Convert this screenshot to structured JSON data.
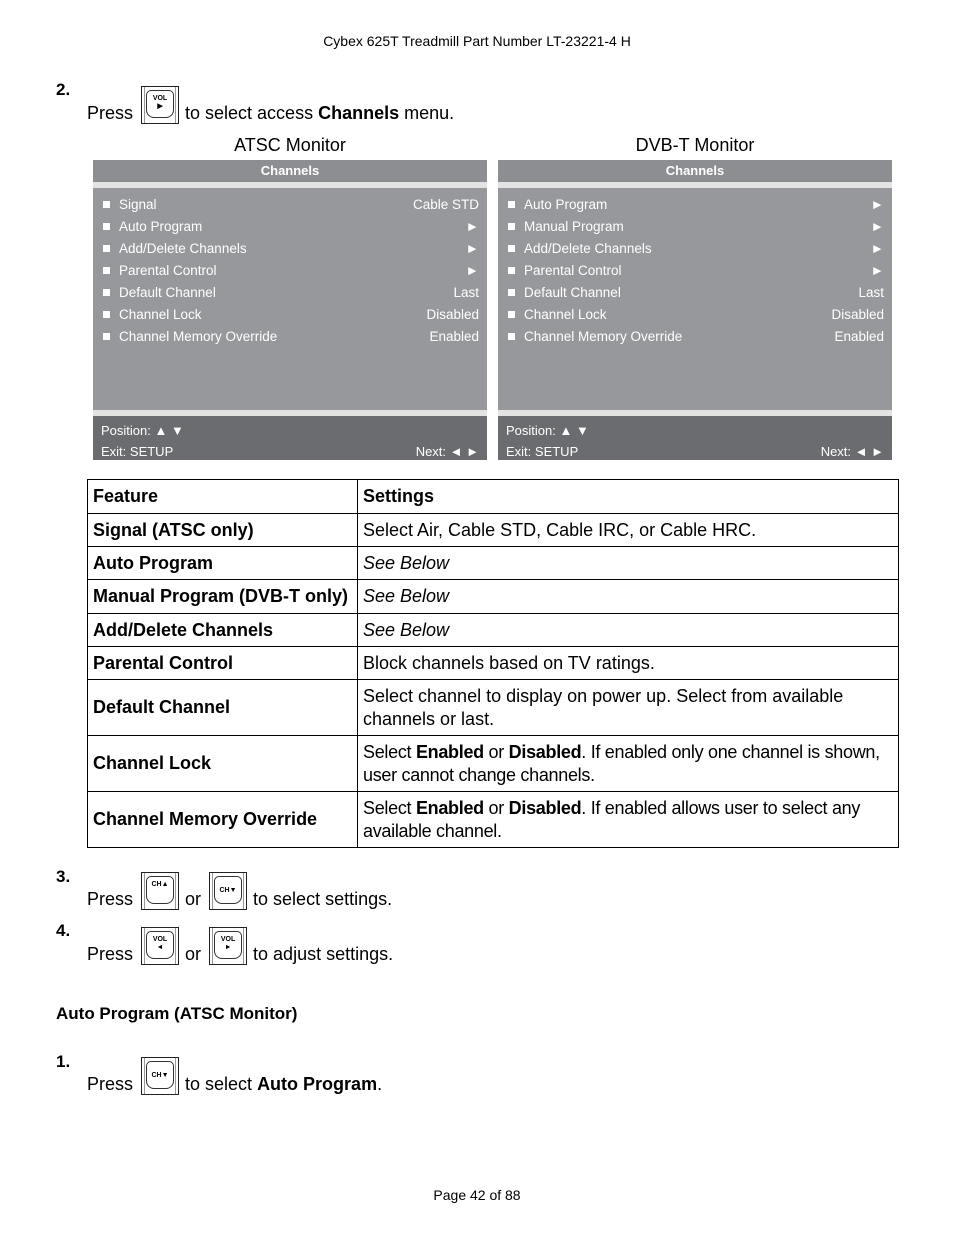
{
  "header": "Cybex 625T Treadmill Part Number LT-23221-4 H",
  "footer": "Page 42 of 88",
  "step2": {
    "num": "2.",
    "press": "Press",
    "key": {
      "icon": "vol-right-key-icon",
      "line1": "VOL",
      "line2": "▶"
    },
    "text_before": "to select access ",
    "text_bold": "Channels",
    "text_after": " menu."
  },
  "monitors": [
    {
      "title": "ATSC Monitor",
      "menu_title": "Channels",
      "items": [
        {
          "label": "Signal",
          "value": "Cable STD"
        },
        {
          "label": "Auto Program",
          "value": "►"
        },
        {
          "label": "Add/Delete Channels",
          "value": "►"
        },
        {
          "label": "Parental Control",
          "value": "►"
        },
        {
          "label": "Default Channel",
          "value": "Last"
        },
        {
          "label": "Channel Lock",
          "value": "Disabled"
        },
        {
          "label": "Channel Memory Override",
          "value": "Enabled"
        }
      ],
      "position_label": "Position: ▲ ▼",
      "exit_label": "Exit: SETUP",
      "next_label": "Next: ◄ ►"
    },
    {
      "title": "DVB-T Monitor",
      "menu_title": "Channels",
      "items": [
        {
          "label": "Auto Program",
          "value": "►"
        },
        {
          "label": "Manual Program",
          "value": "►"
        },
        {
          "label": "Add/Delete Channels",
          "value": "►"
        },
        {
          "label": "Parental Control",
          "value": "►"
        },
        {
          "label": "Default Channel",
          "value": "Last"
        },
        {
          "label": "Channel Lock",
          "value": "Disabled"
        },
        {
          "label": "Channel Memory Override",
          "value": "Enabled"
        }
      ],
      "position_label": "Position: ▲ ▼",
      "exit_label": "Exit: SETUP",
      "next_label": "Next: ◄ ►"
    }
  ],
  "table": {
    "headers": [
      "Feature",
      "Settings"
    ],
    "rows": [
      {
        "feature": "Signal (ATSC only)",
        "settings": "Select Air, Cable STD, Cable IRC, or Cable HRC."
      },
      {
        "feature": "Auto Program",
        "settings": "See Below"
      },
      {
        "feature": "Manual Program (DVB-T only)",
        "settings": "See Below"
      },
      {
        "feature": "Add/Delete Channels",
        "settings": "See Below"
      },
      {
        "feature": "Parental Control",
        "settings": "Block channels based on TV ratings."
      },
      {
        "feature": "Default Channel",
        "settings": "Select channel to display on power up. Select from available channels or last."
      },
      {
        "feature": "Channel Lock",
        "settings_parts": [
          "Select ",
          "Enabled",
          " or ",
          "Disabled",
          ". If enabled only one channel is shown, user cannot change channels."
        ]
      },
      {
        "feature": "Channel Memory Override",
        "settings_parts": [
          "Select ",
          "Enabled",
          " or ",
          "Disabled",
          ". If enabled allows user to select any available channel."
        ]
      }
    ]
  },
  "step3": {
    "num": "3.",
    "press": "Press",
    "key1": {
      "line1": "CH▲"
    },
    "or": "or",
    "key2": {
      "line1": "CH▼"
    },
    "text": "to select settings."
  },
  "step4": {
    "num": "4.",
    "press": "Press",
    "key1": {
      "line1": "VOL",
      "line2": "◄"
    },
    "or": "or",
    "key2": {
      "line1": "VOL",
      "line2": "►"
    },
    "text": "to adjust settings."
  },
  "section": {
    "title": "Auto Program (ATSC Monitor)",
    "step1": {
      "num": "1.",
      "press": "Press",
      "key": {
        "line1": "CH▼"
      },
      "text_before": "to select ",
      "text_bold": "Auto Program",
      "text_after": "."
    }
  }
}
